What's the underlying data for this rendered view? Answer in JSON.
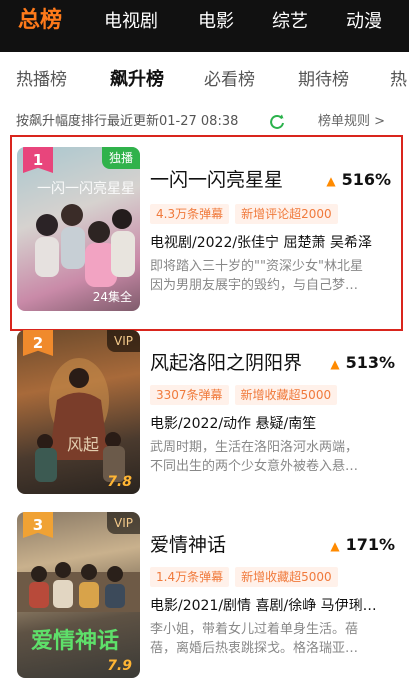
{
  "top_nav": {
    "tabs": [
      "总榜",
      "电视剧",
      "电影",
      "综艺",
      "动漫"
    ]
  },
  "sub_tabs": {
    "tabs": [
      "热播榜",
      "飙升榜",
      "必看榜",
      "期待榜",
      "热"
    ]
  },
  "info_bar": {
    "description": "按飙升幅度排行最近更新01-27 08:38",
    "rules": "榜单规则 >"
  },
  "items": [
    {
      "rank": "1",
      "badge": "独播",
      "poster_caption": "24集全",
      "title": "一闪一闪亮星星",
      "trend": "516%",
      "chips": [
        "4.3万条弹幕",
        "新增评论超2000"
      ],
      "meta": "电视剧/2022/张佳宁 屈楚萧 吴希泽",
      "desc_line1": "即将踏入三十岁的\"\"资深少女\"林北星",
      "desc_line2": "因为男朋友展宇的毁约，与自己梦…"
    },
    {
      "rank": "2",
      "badge": "VIP",
      "poster_caption": "7.8",
      "title": "风起洛阳之阴阳界",
      "trend": "513%",
      "chips": [
        "3307条弹幕",
        "新增收藏超5000"
      ],
      "meta": "电影/2022/动作 悬疑/南笙",
      "desc_line1": "武周时期，生活在洛阳洛河水两端，",
      "desc_line2": "不同出生的两个少女意外被卷入悬…"
    },
    {
      "rank": "3",
      "badge": "VIP",
      "poster_caption": "7.9",
      "title": "爱情神话",
      "trend": "171%",
      "chips": [
        "1.4万条弹幕",
        "新增收藏超5000"
      ],
      "meta": "电影/2021/剧情 喜剧/徐峥 马伊琍…",
      "desc_line1": "李小姐，带着女儿过着单身生活。蓓",
      "desc_line2": "蓓，离婚后热衷跳探戈。格洛瑞亚…"
    }
  ],
  "colors": {
    "accent": "#ff7a1a",
    "rank1": "#e8457c",
    "rank2": "#f08a2c",
    "rank3": "#f0a234",
    "highlight_border": "#d9251d",
    "chip_text": "#f07a3c"
  },
  "icons": [
    "refresh-icon",
    "trend-up-icon"
  ]
}
